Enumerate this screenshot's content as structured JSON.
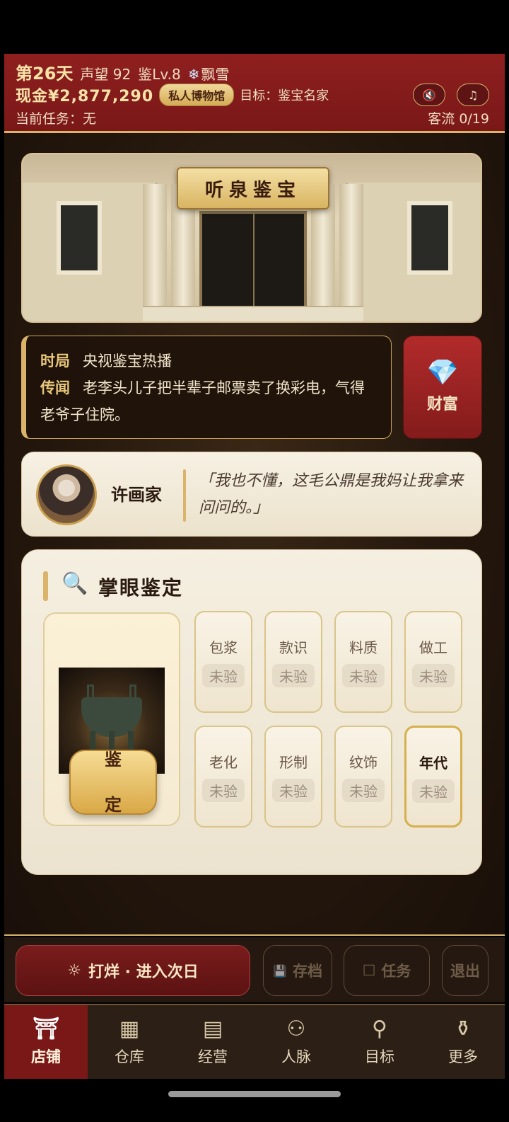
{
  "header": {
    "day": "第26天",
    "reputation": "声望 92",
    "level": "鉴Lv.8",
    "weather_icon": "❄",
    "weather": "飘雪",
    "cash": "现金¥2,877,290",
    "badge": "私人博物馆",
    "goal": "目标：鉴宝名家",
    "task": "当前任务：无",
    "traffic": "客流 0/19",
    "mute_icon": "🔇",
    "music_icon": "♫"
  },
  "banner": {
    "shop_name": "听泉鉴宝"
  },
  "news": {
    "situation_key": "时局",
    "situation": "央视鉴宝热播",
    "rumor_key": "传闻",
    "rumor": "老李头儿子把半辈子邮票卖了换彩电，气得老爷子住院。"
  },
  "wealth": {
    "icon": "💎",
    "label": "财富"
  },
  "dialog": {
    "speaker": "许画家",
    "quote": "「我也不懂，这毛公鼎是我妈让我拿来问问的。」"
  },
  "appraise": {
    "icon": "🔍",
    "title": "掌眼鉴定",
    "button": [
      "鉴",
      "定"
    ],
    "attributes": [
      {
        "name": "包浆",
        "status": "未验"
      },
      {
        "name": "款识",
        "status": "未验"
      },
      {
        "name": "料质",
        "status": "未验"
      },
      {
        "name": "做工",
        "status": "未验"
      },
      {
        "name": "老化",
        "status": "未验"
      },
      {
        "name": "形制",
        "status": "未验"
      },
      {
        "name": "纹饰",
        "status": "未验"
      },
      {
        "name": "年代",
        "status": "未验"
      }
    ]
  },
  "actions": {
    "next_icon": "☼",
    "next": "打烊 · 进入次日",
    "save_icon": "💾",
    "save": "存档",
    "task_icon": "☐",
    "task": "任务",
    "exit": "退出"
  },
  "nav": [
    {
      "icon": "⛩",
      "label": "店铺"
    },
    {
      "icon": "▦",
      "label": "仓库"
    },
    {
      "icon": "▤",
      "label": "经营"
    },
    {
      "icon": "⚇",
      "label": "人脉"
    },
    {
      "icon": "⚲",
      "label": "目标"
    },
    {
      "icon": "⚱",
      "label": "更多"
    }
  ]
}
